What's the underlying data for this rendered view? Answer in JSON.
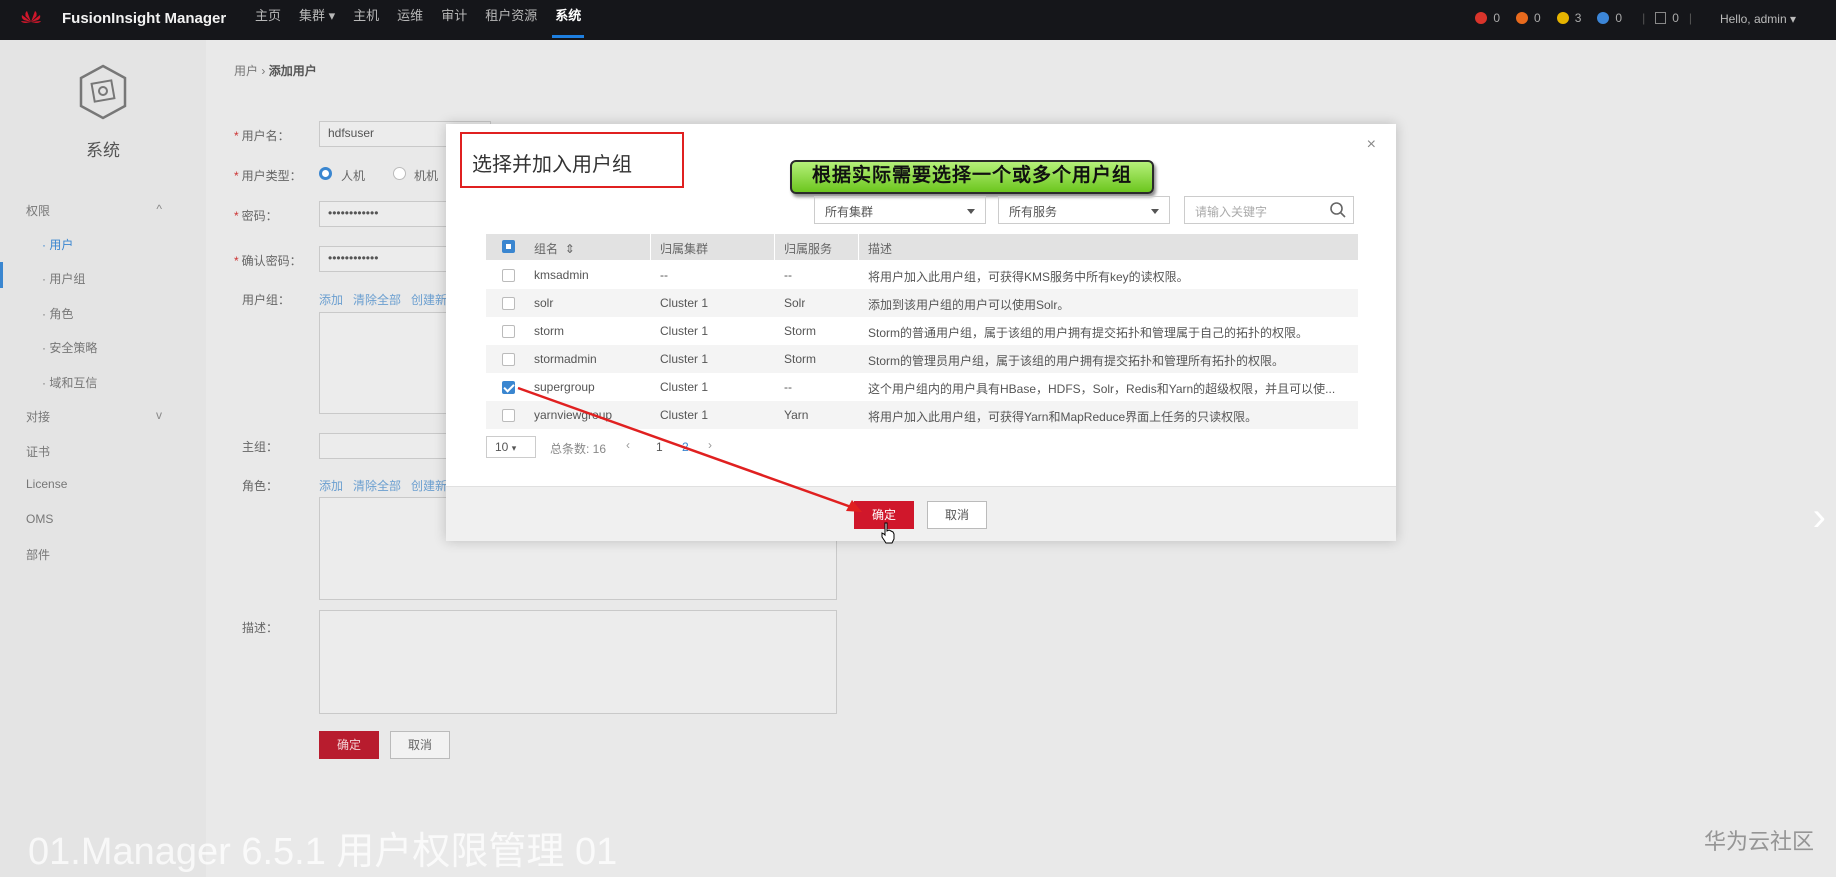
{
  "topbar": {
    "brand": "FusionInsight Manager",
    "logo_label": "HUAWEI",
    "nav": [
      "主页",
      "集群 ▾",
      "主机",
      "运维",
      "审计",
      "租户资源",
      "系统"
    ],
    "alerts": [
      {
        "color": "#d9342b",
        "count": "0"
      },
      {
        "color": "#e86a1d",
        "count": "0"
      },
      {
        "color": "#e6b400",
        "count": "3"
      },
      {
        "color": "#3c86d8",
        "count": "0"
      }
    ],
    "task_count": "0",
    "user": "Hello, admin ▾"
  },
  "sidebar": {
    "title": "系统",
    "sections": [
      {
        "label": "权限",
        "caret": "^"
      },
      {
        "label": "对接",
        "caret": "v"
      },
      {
        "label": "证书"
      },
      {
        "label": "License"
      },
      {
        "label": "OMS"
      },
      {
        "label": "部件"
      }
    ],
    "sub_items": [
      "· 用户",
      "· 用户组",
      "· 角色",
      "· 安全策略",
      "· 域和互信"
    ]
  },
  "breadcrumb": {
    "parent": "用户",
    "sep": " › ",
    "current": "添加用户"
  },
  "form": {
    "username_label": "用户名：",
    "username_value": "hdfsuser",
    "usertype_label": "用户类型：",
    "usertype_human": "人机",
    "usertype_machine": "机机",
    "password_label": "密码：",
    "password_value": "••••••••••••",
    "confirm_label": "确认密码：",
    "confirm_value": "••••••••••••",
    "usergroup_label": "用户组：",
    "links": [
      "添加",
      "清除全部",
      "创建新"
    ],
    "primary_group_label": "主组：",
    "role_label": "角色：",
    "desc_label": "描述：",
    "ok": "确定",
    "cancel": "取消"
  },
  "modal": {
    "title": "选择并加入用户组",
    "close": "×",
    "hint": "根据实际需要选择一个或多个用户组",
    "cluster_filter": "所有集群",
    "service_filter": "所有服务",
    "search_placeholder": "请输入关键字",
    "columns": [
      "组名",
      "归属集群",
      "归属服务",
      "描述"
    ],
    "rows": [
      {
        "name": "kmsadmin",
        "cluster": "--",
        "service": "--",
        "desc": "将用户加入此用户组，可获得KMS服务中所有key的读权限。",
        "checked": false
      },
      {
        "name": "solr",
        "cluster": "Cluster 1",
        "service": "Solr",
        "desc": "添加到该用户组的用户可以使用Solr。",
        "checked": false
      },
      {
        "name": "storm",
        "cluster": "Cluster 1",
        "service": "Storm",
        "desc": "Storm的普通用户组，属于该组的用户拥有提交拓扑和管理属于自己的拓扑的权限。",
        "checked": false
      },
      {
        "name": "stormadmin",
        "cluster": "Cluster 1",
        "service": "Storm",
        "desc": "Storm的管理员用户组，属于该组的用户拥有提交拓扑和管理所有拓扑的权限。",
        "checked": false
      },
      {
        "name": "supergroup",
        "cluster": "Cluster 1",
        "service": "--",
        "desc": "这个用户组内的用户具有HBase，HDFS，Solr，Redis和Yarn的超级权限，并且可以使...",
        "checked": true
      },
      {
        "name": "yarnviewgroup",
        "cluster": "Cluster 1",
        "service": "Yarn",
        "desc": "将用户加入此用户组，可获得Yarn和MapReduce界面上任务的只读权限。",
        "checked": false
      }
    ],
    "pager": {
      "size": "10",
      "total": "总条数: 16",
      "page1": "1",
      "page2": "2"
    },
    "ok": "确定",
    "cancel": "取消"
  },
  "watermark": "01.Manager 6.5.1 用户权限管理 01",
  "site": "华为云社区"
}
